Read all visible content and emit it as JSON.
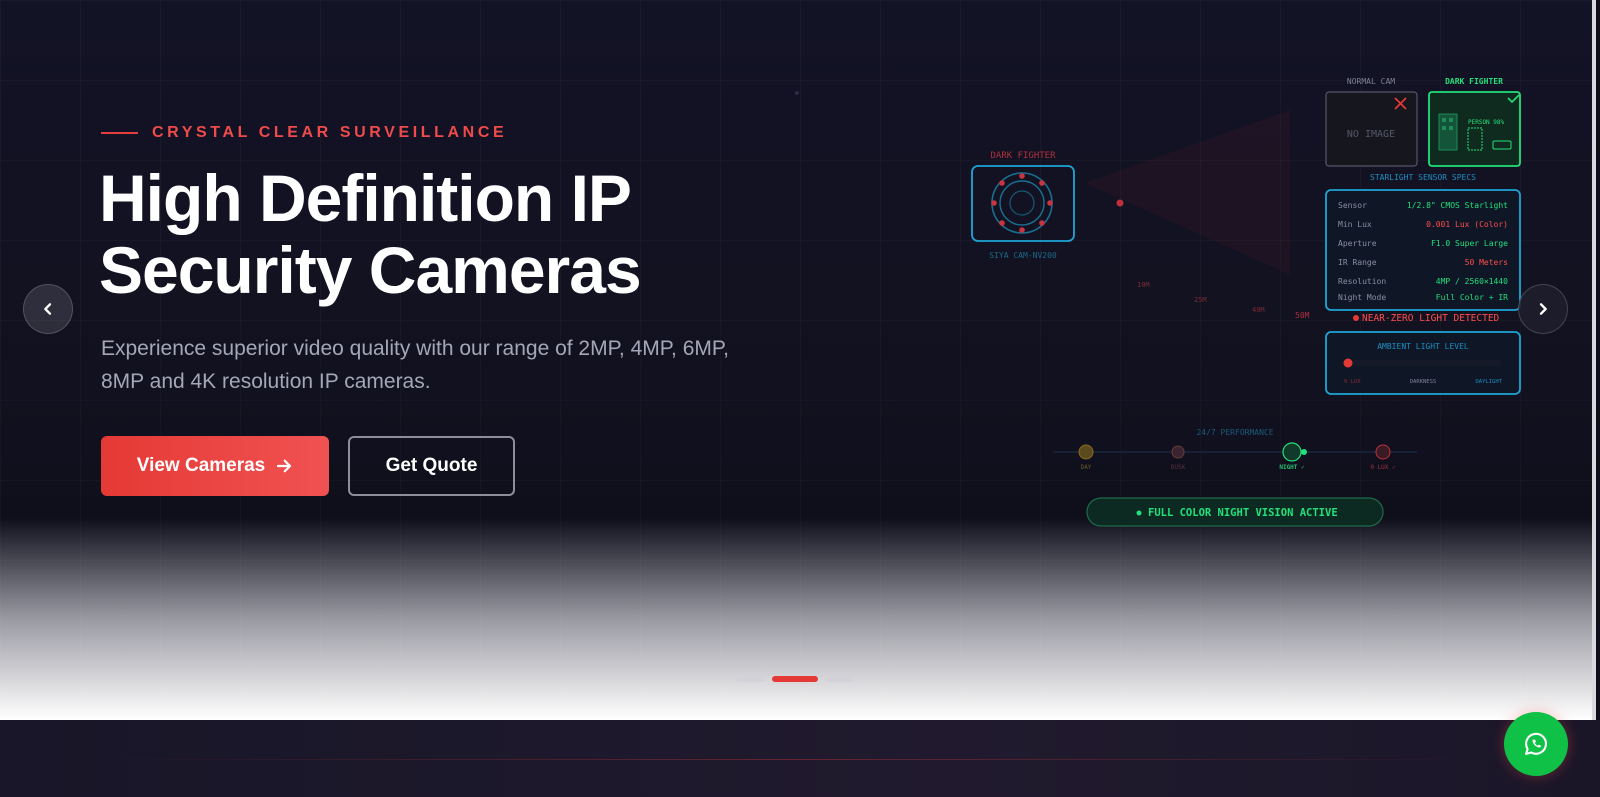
{
  "hero": {
    "eyebrow": "CRYSTAL CLEAR SURVEILLANCE",
    "title_line1": "High Definition IP",
    "title_line2": "Security Cameras",
    "subtitle": "Experience superior video quality with our range of 2MP, 4MP, 6MP, 8MP and 4K resolution IP cameras.",
    "primary_button": "View Cameras",
    "secondary_button": "Get Quote"
  },
  "illustration": {
    "camera_label": "DARK FIGHTER",
    "camera_model": "SIYA CAM-NV200",
    "normal_cam_label": "NORMAL CAM",
    "dark_fighter_label": "DARK FIGHTER",
    "no_image": "NO IMAGE",
    "person_tag": "PERSON 98%",
    "specs_title": "STARLIGHT SENSOR SPECS",
    "specs": [
      {
        "label": "Sensor",
        "value": "1/2.8\" CMOS Starlight",
        "color": "#22e07a"
      },
      {
        "label": "Min Lux",
        "value": "0.001 Lux (Color)",
        "color": "#ff4d4d"
      },
      {
        "label": "Aperture",
        "value": "F1.0 Super Large",
        "color": "#22e07a"
      },
      {
        "label": "IR Range",
        "value": "50 Meters",
        "color": "#ff4d4d"
      },
      {
        "label": "Resolution",
        "value": "4MP / 2560×1440",
        "color": "#22e07a"
      },
      {
        "label": "Night Mode",
        "value": "Full Color + IR",
        "color": "#22e07a"
      }
    ],
    "alert": "NEAR-ZERO LIGHT DETECTED",
    "ambient_title": "AMBIENT LIGHT LEVEL",
    "ambient_labels": [
      "0 LUX",
      "DARKNESS",
      "DAYLIGHT"
    ],
    "range_marks": [
      "10M",
      "25M",
      "40M",
      "50M"
    ],
    "performance_title": "24/7 PERFORMANCE",
    "performance_steps": [
      "DAY",
      "DUSK",
      "NIGHT ✓",
      "0 LUX ✓"
    ],
    "status_badge": "FULL COLOR NIGHT VISION ACTIVE"
  },
  "carousel": {
    "slides": 3,
    "active_index": 1
  },
  "colors": {
    "accent": "#e53935",
    "success": "#22e07a",
    "cyan": "#1ea5d6",
    "whatsapp": "#0fc247"
  },
  "icons": {
    "prev": "chevron-left-icon",
    "next": "chevron-right-icon",
    "arrow": "arrow-right-icon",
    "chat": "whatsapp-icon"
  }
}
